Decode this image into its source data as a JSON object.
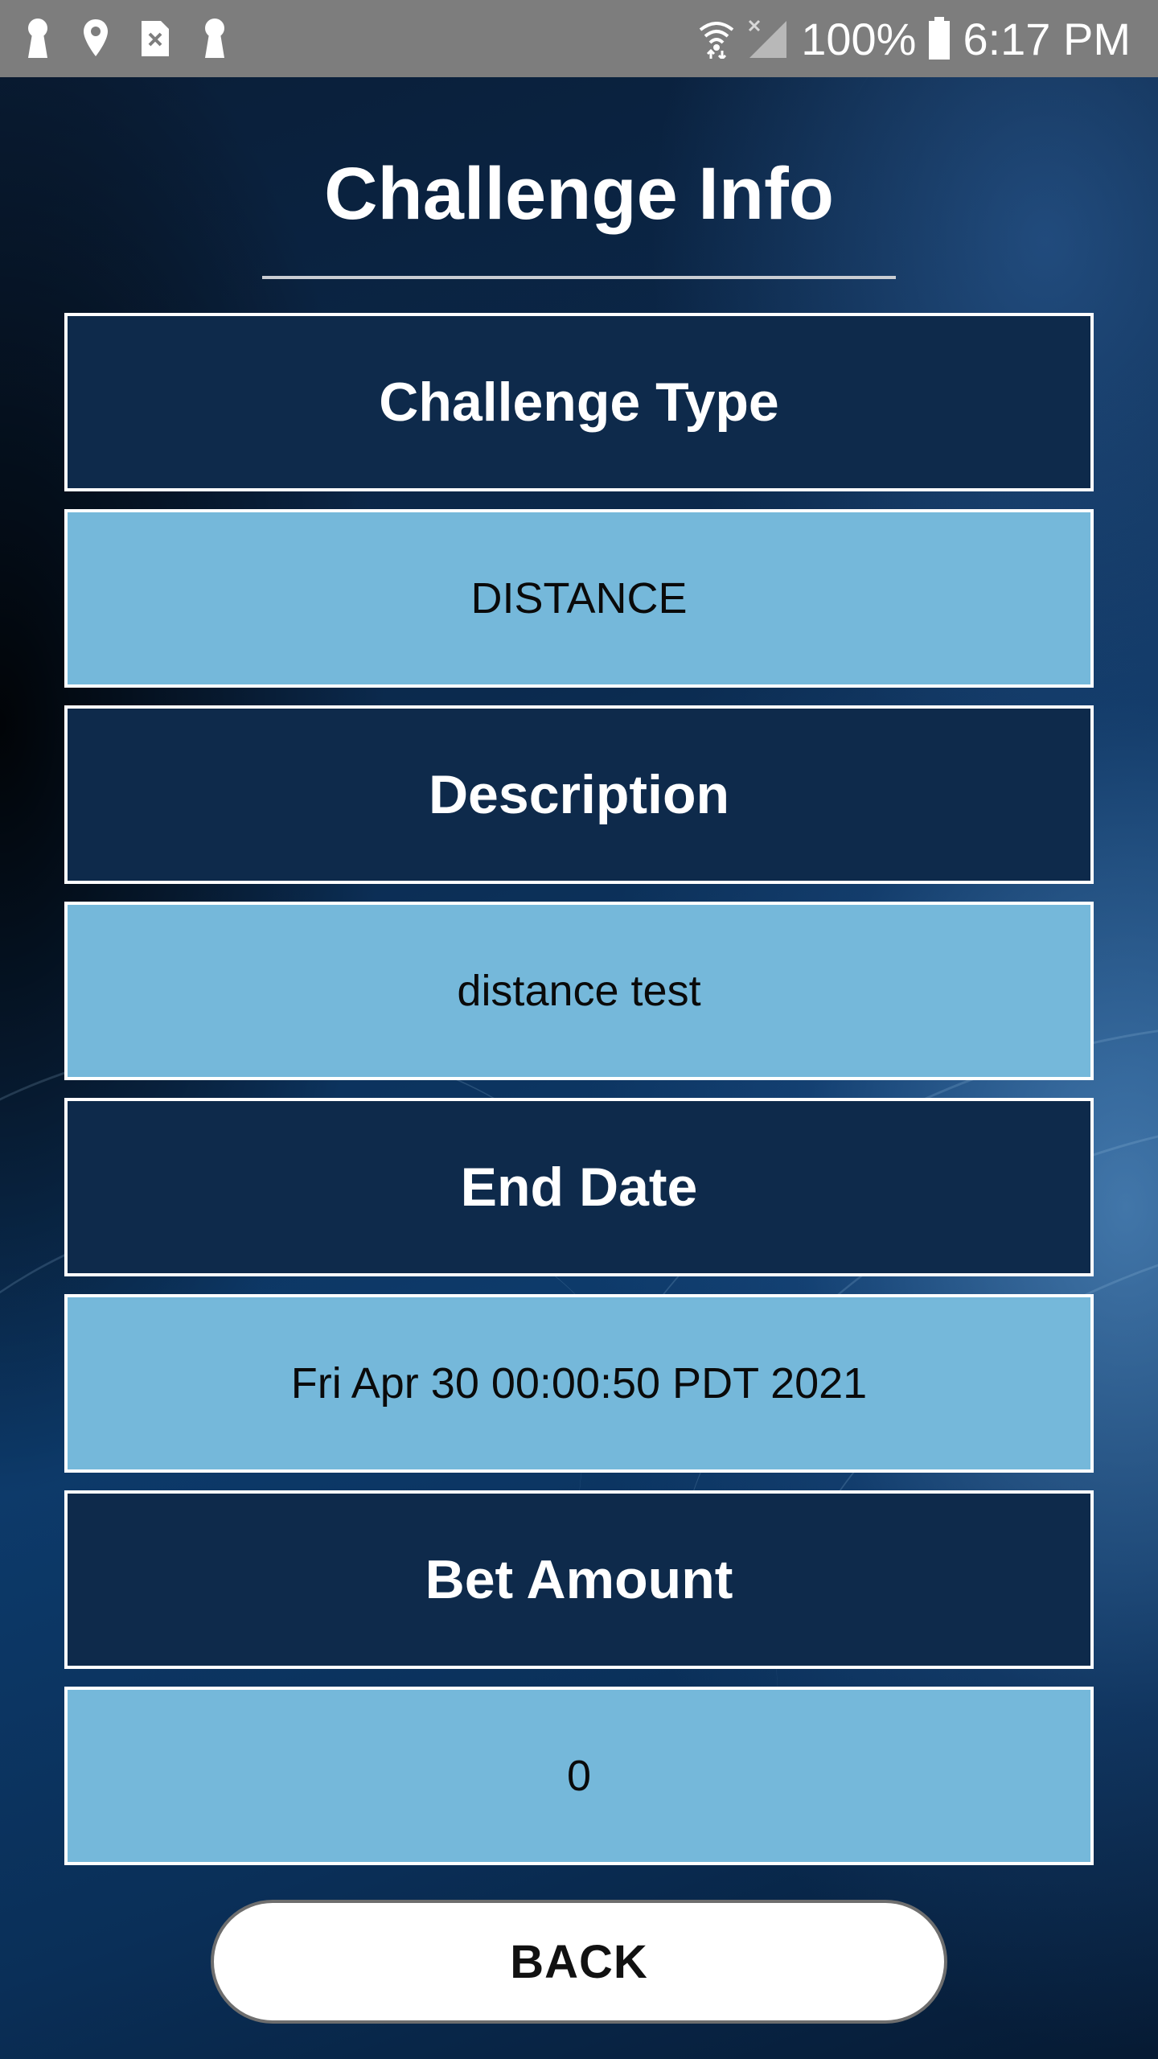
{
  "status_bar": {
    "left_icons": [
      "keyhole-icon",
      "location-pin-icon",
      "sim-card-icon",
      "keyhole-icon"
    ],
    "right_icons": [
      "wifi-icon",
      "signal-icon",
      "battery-icon"
    ],
    "battery": "100%",
    "time": "6:17 PM"
  },
  "page": {
    "title": "Challenge Info"
  },
  "sections": [
    {
      "label": "Challenge Type",
      "value": "DISTANCE"
    },
    {
      "label": "Description",
      "value": "distance test"
    },
    {
      "label": "End Date",
      "value": "Fri Apr 30 00:00:50 PDT 2021"
    },
    {
      "label": "Bet Amount",
      "value": "0"
    }
  ],
  "actions": {
    "back_label": "BACK"
  },
  "colors": {
    "header_box": "#0e2a4b",
    "value_box": "#75b8da",
    "status_bar": "#7d7d7d",
    "button_bg": "#ffffff"
  }
}
